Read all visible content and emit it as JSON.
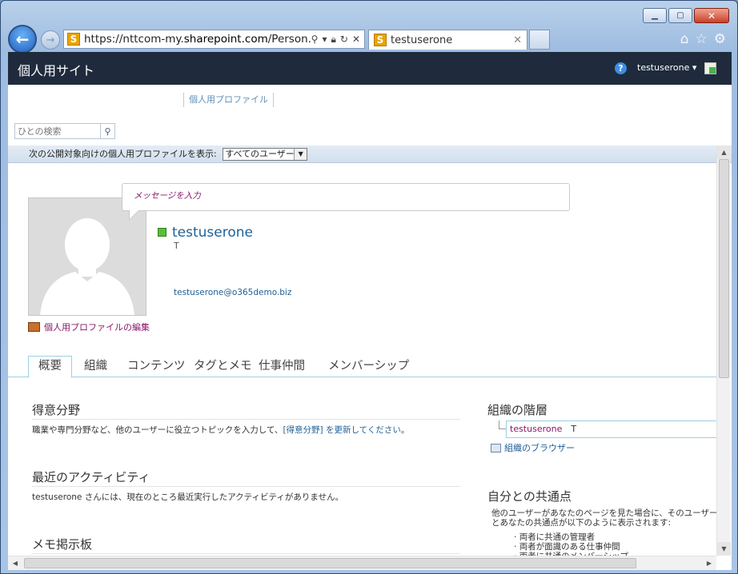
{
  "browser": {
    "address": {
      "prefix": "https://nttcom-my.",
      "domain": "sharepoint.com",
      "suffix": "/Person.as"
    },
    "tab_title": "testuserone",
    "favicon_letter": "S"
  },
  "suitebar": {
    "site_title": "個人用サイト",
    "help_glyph": "?",
    "user_name": "testuserone"
  },
  "top_link": "個人用プロファイル",
  "search": {
    "placeholder": "ひとの検索"
  },
  "audience": {
    "label": "次の公開対象向けの個人用プロファイルを表示:",
    "selected": "すべてのユーザー"
  },
  "status_prompt": "メッセージを入力",
  "profile": {
    "name": "testuserone",
    "initial": "T",
    "email": "testuserone@o365demo.biz",
    "edit_label": "個人用プロファイルの編集"
  },
  "tabs": [
    "概要",
    "組織",
    "コンテンツ",
    "タグとメモ",
    "仕事仲間",
    "メンバーシップ"
  ],
  "sections": {
    "expertise": {
      "title": "得意分野",
      "body_prefix": "職業や専門分野など、他のユーザーに役立つトピックを入力して、",
      "body_link": "[得意分野] を更新してください",
      "body_suffix": "。"
    },
    "activity": {
      "title": "最近のアクティビティ",
      "body": "testuserone さんには、現在のところ最近実行したアクティビティがありません。"
    },
    "noteboard": {
      "title": "メモ掲示板"
    },
    "org": {
      "title": "組織の階層",
      "entry_name": "testuserone",
      "entry_initial": "T",
      "browser_link": "組織のブラウザー"
    },
    "common": {
      "title": "自分との共通点",
      "body": "他のユーザーがあなたのページを見た場合に、そのユーザーとあなたの共通点が以下のように表示されます:",
      "items": [
        "両者に共通の管理者",
        "両者が面識のある仕事仲間",
        "両者に共通のメンバーシップ"
      ]
    }
  }
}
